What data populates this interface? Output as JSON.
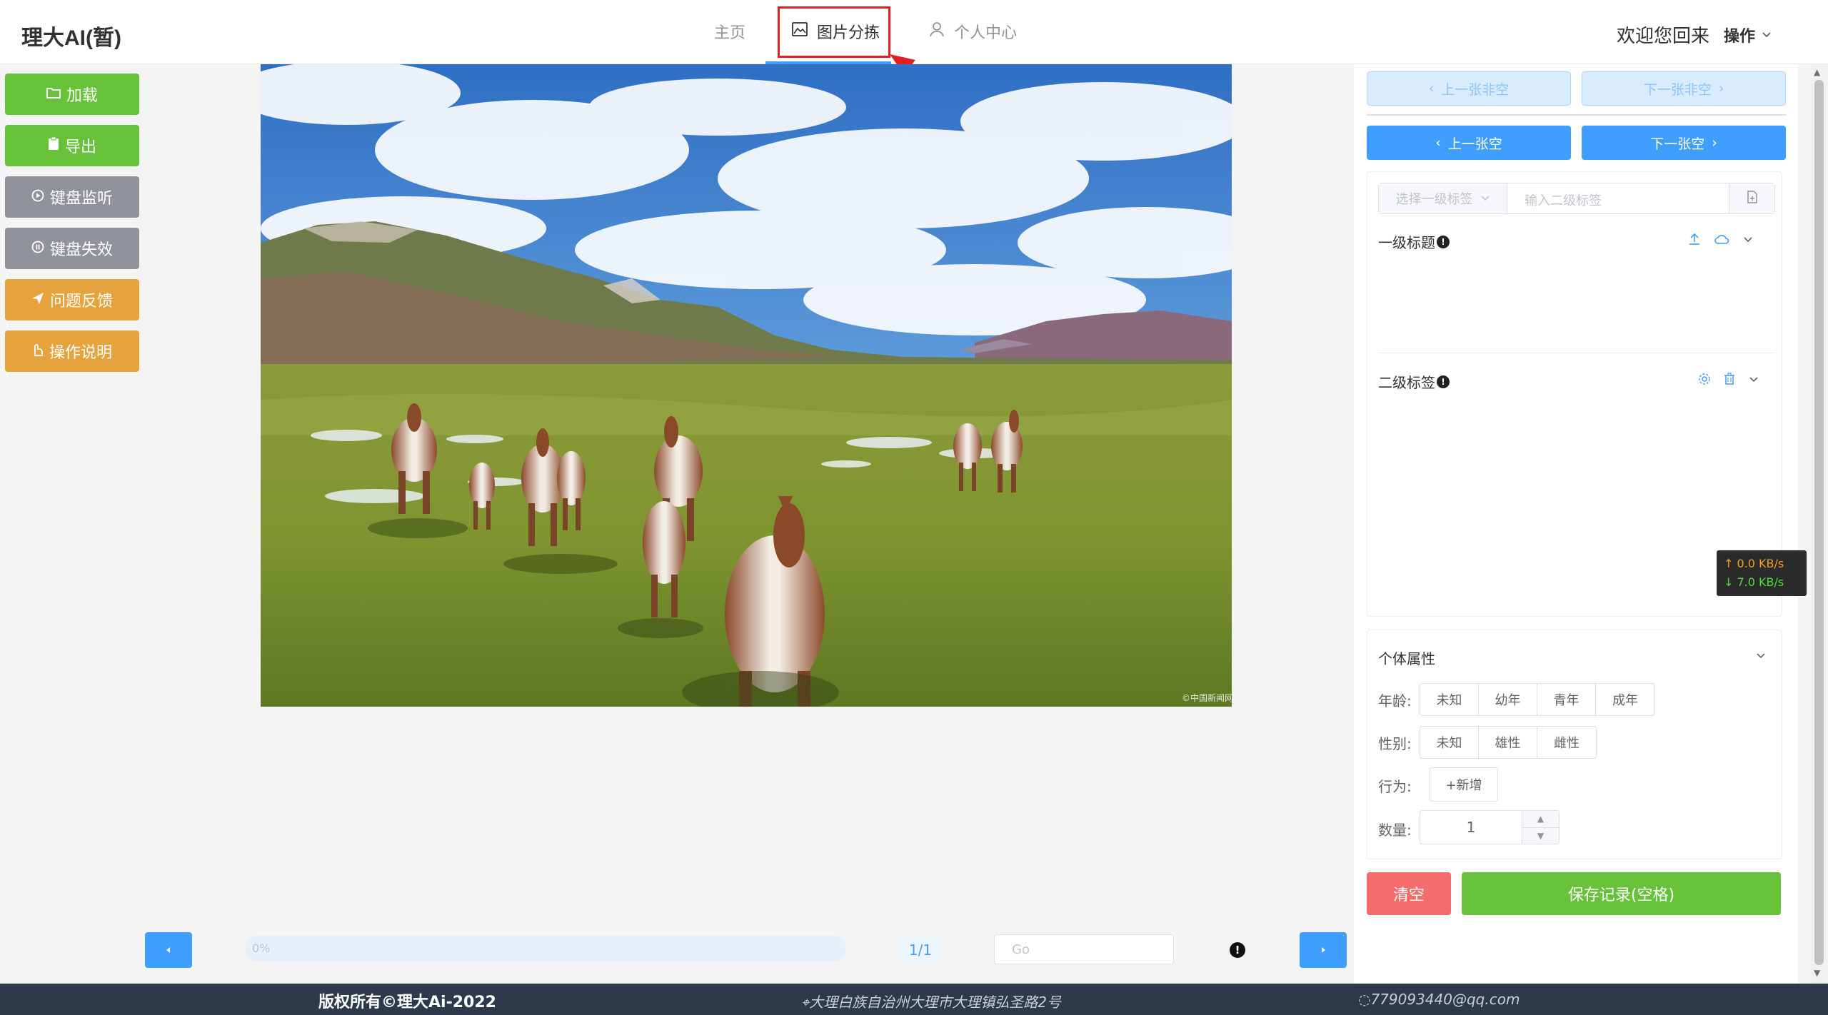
{
  "header": {
    "brand": "理大AI(暂)",
    "nav": [
      {
        "label": "主页"
      },
      {
        "label": "图片分拣"
      },
      {
        "label": "个人中心"
      }
    ],
    "welcome": "欢迎您回来",
    "ops": "操作"
  },
  "left_toolbar": [
    {
      "label": "加载",
      "icon": "folder-icon"
    },
    {
      "label": "导出",
      "icon": "clipboard-icon"
    },
    {
      "label": "键盘监听",
      "icon": "play-circle-icon"
    },
    {
      "label": "键盘失效",
      "icon": "pause-circle-icon"
    },
    {
      "label": "问题反馈",
      "icon": "send-icon"
    },
    {
      "label": "操作说明",
      "icon": "hand-icon"
    }
  ],
  "image": {
    "subject": "wild donkeys running across a grassland under blue sky",
    "watermark": "©中国新闻网"
  },
  "pager": {
    "progress": "0%",
    "page": "1/1",
    "go_placeholder": "Go"
  },
  "right_panel": {
    "prev_nonempty": "上一张非空",
    "next_nonempty": "下一张非空",
    "prev_empty": "上一张空",
    "next_empty": "下一张空",
    "select_placeholder": "选择一级标签",
    "input_placeholder": "输入二级标签",
    "level1_title": "一级标题",
    "level2_title": "二级标签",
    "attr_title": "个体属性",
    "age_label": "年龄:",
    "age_options": [
      "未知",
      "幼年",
      "青年",
      "成年"
    ],
    "sex_label": "性别:",
    "sex_options": [
      "未知",
      "雄性",
      "雌性"
    ],
    "behavior_label": "行为:",
    "behavior_add": "+新增",
    "count_label": "数量:",
    "count_value": "1",
    "clear": "清空",
    "save": "保存记录(空格)"
  },
  "speed": {
    "up": "↑ 0.0 KB/s",
    "down": "↓ 7.0 KB/s"
  },
  "footer": {
    "copyright": "版权所有©理大Ai-2022",
    "address": "大理白族自治州大理市大理镇弘圣路2号",
    "email": "779093440@qq.com"
  },
  "colors": {
    "primary": "#409eff",
    "success": "#67c23a",
    "warning": "#e6a23c",
    "info": "#909399",
    "danger": "#f56c6c",
    "footer": "#2e3a4c"
  }
}
